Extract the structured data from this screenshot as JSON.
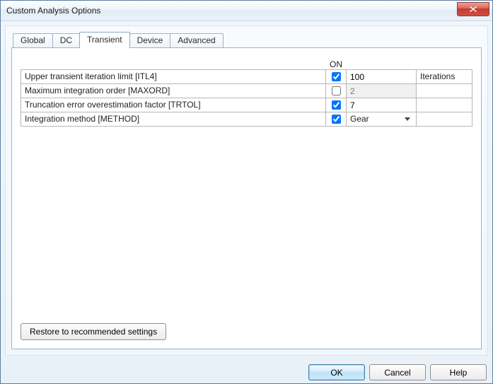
{
  "window": {
    "title": "Custom Analysis Options"
  },
  "tabs": [
    {
      "label": "Global",
      "active": false
    },
    {
      "label": "DC",
      "active": false
    },
    {
      "label": "Transient",
      "active": true
    },
    {
      "label": "Device",
      "active": false
    },
    {
      "label": "Advanced",
      "active": false
    }
  ],
  "columns": {
    "on": "ON"
  },
  "rows": [
    {
      "label": "Upper transient iteration limit [ITL4]",
      "on": true,
      "value": "100",
      "unit": "Iterations",
      "kind": "text",
      "enabled": true
    },
    {
      "label": "Maximum integration order [MAXORD]",
      "on": false,
      "value": "2",
      "unit": "",
      "kind": "text",
      "enabled": false
    },
    {
      "label": "Truncation error overestimation factor [TRTOL]",
      "on": true,
      "value": "7",
      "unit": "",
      "kind": "text",
      "enabled": true
    },
    {
      "label": "Integration method [METHOD]",
      "on": true,
      "value": "Gear",
      "unit": "",
      "kind": "select",
      "enabled": true
    }
  ],
  "buttons": {
    "restore": "Restore to recommended settings",
    "ok": "OK",
    "cancel": "Cancel",
    "help": "Help"
  }
}
